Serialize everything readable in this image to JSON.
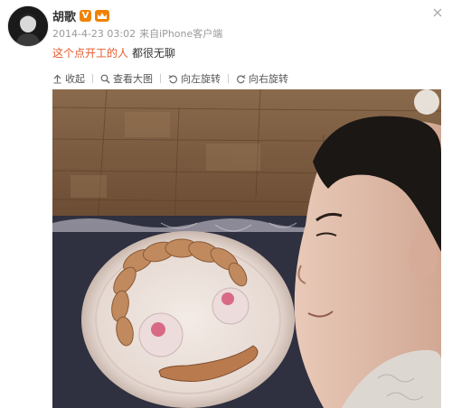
{
  "user": {
    "name": "胡歌",
    "verified_badge": "V",
    "avatar_icon": "user-avatar-icon"
  },
  "post": {
    "timestamp": "2014-4-23 03:02",
    "source_prefix": "来自",
    "source": "iPhone客户端",
    "text_highlight": "这个点开工的人",
    "text_rest": "都很无聊"
  },
  "toolbar": {
    "collapse": "收起",
    "view_large": "查看大图",
    "rotate_left": "向左旋转",
    "rotate_right": "向右旋转"
  },
  "colors": {
    "highlight_text": "#e45a2b",
    "badge_orange": "#f08200",
    "meta_gray": "#999999"
  }
}
